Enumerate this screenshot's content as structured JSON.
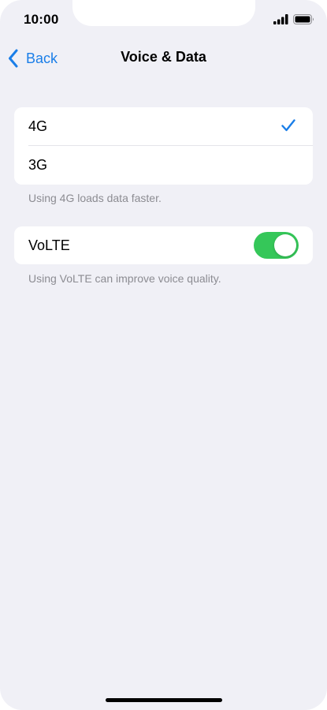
{
  "status_bar": {
    "time": "10:00",
    "icons": [
      "signal-icon",
      "battery-icon"
    ]
  },
  "nav": {
    "back_label": "Back",
    "title": "Voice & Data",
    "back_icon": "chevron-left-icon"
  },
  "network_options": {
    "items": [
      {
        "label": "4G",
        "selected": true
      },
      {
        "label": "3G",
        "selected": false
      }
    ],
    "footer": "Using 4G loads data faster."
  },
  "volte": {
    "label": "VoLTE",
    "enabled": true,
    "footer": "Using VoLTE can improve voice quality."
  },
  "colors": {
    "accent": "#1a7ee8",
    "toggle_on": "#35c759",
    "background": "#f0f0f6"
  }
}
